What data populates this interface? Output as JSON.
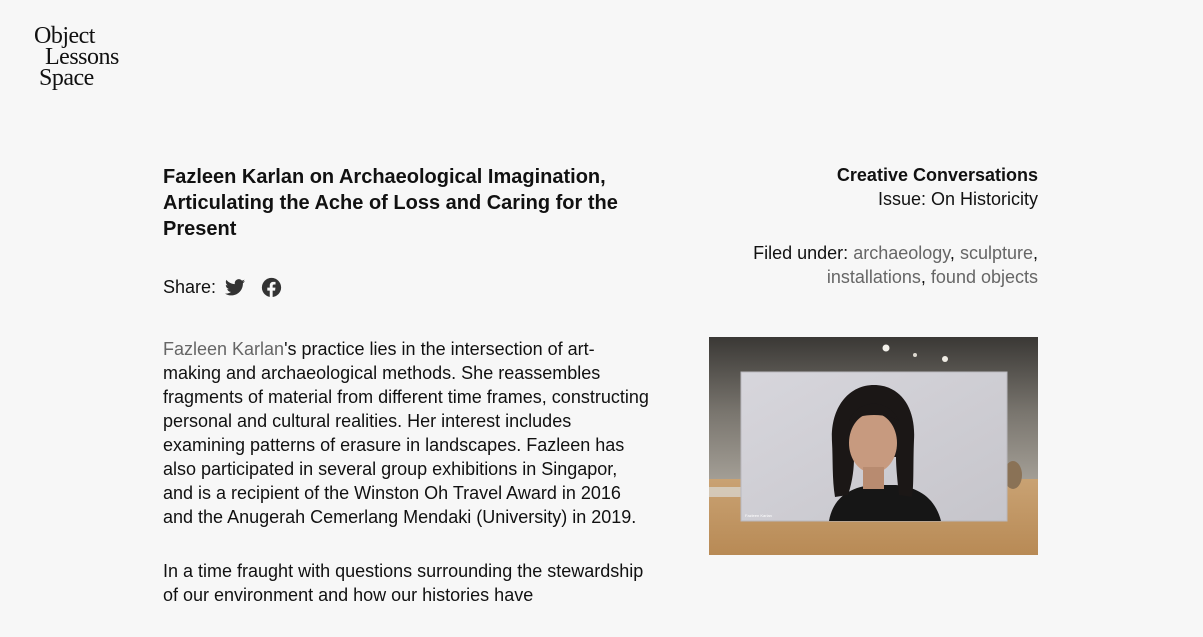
{
  "logo": {
    "line1": "Object",
    "line2": "Lessons",
    "line3": "Space"
  },
  "article": {
    "title": "Fazleen Karlan on Archaeological Imagination, Articulating the Ache of Loss and Caring for the Present",
    "share_label": "Share:",
    "share_icons": [
      "twitter-icon",
      "facebook-icon"
    ],
    "paragraph1_link": "Fazleen Karlan",
    "paragraph1_rest": "'s practice lies in the intersection of art-making and archaeological methods. She reassembles fragments of material from different time frames, constructing personal and cultural realities. Her interest includes examining patterns of erasure in landscapes. Fazleen has also participated in several group exhibitions in Singapor, and is a recipient of the Winston Oh Travel Award in 2016 and the Anugerah Cemerlang Mendaki (University) in 2019.",
    "paragraph2": "In a time fraught with questions surrounding the stewardship of our environment and how our histories have"
  },
  "aside": {
    "series": "Creative Conversations",
    "issue": "Issue: On Historicity",
    "filed_label": "Filed under:",
    "tags": [
      "archaeology",
      "sculpture",
      "installations",
      "found objects"
    ],
    "separator": ", "
  },
  "video": {
    "name_tag": "Fazleen Karlan"
  }
}
